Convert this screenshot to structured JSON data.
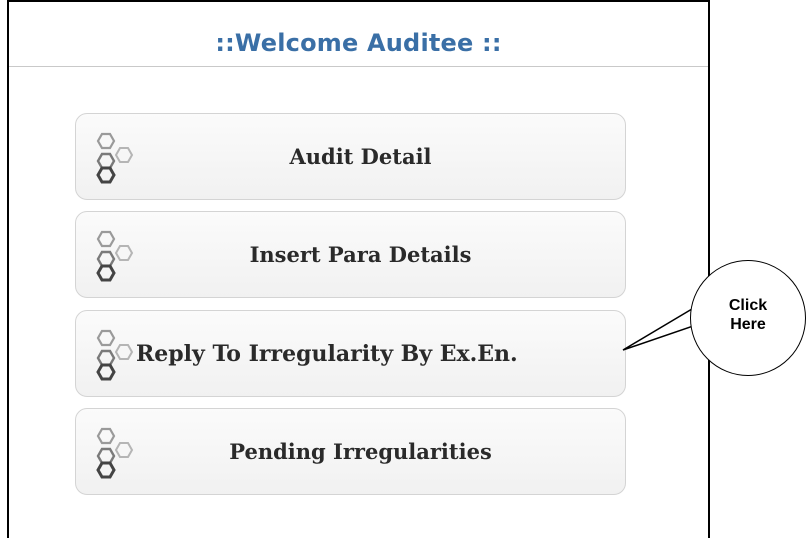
{
  "header": {
    "title": "::Welcome Auditee ::",
    "title_color": "#3a6fa6"
  },
  "menu": {
    "icon": "hexagon-cluster-icon",
    "items": [
      {
        "label": "Audit Detail"
      },
      {
        "label": "Insert Para Details"
      },
      {
        "label": "Reply To Irregularity By Ex.En."
      },
      {
        "label": "Pending Irregularities"
      }
    ]
  },
  "callout": {
    "text": "Click\nHere"
  }
}
